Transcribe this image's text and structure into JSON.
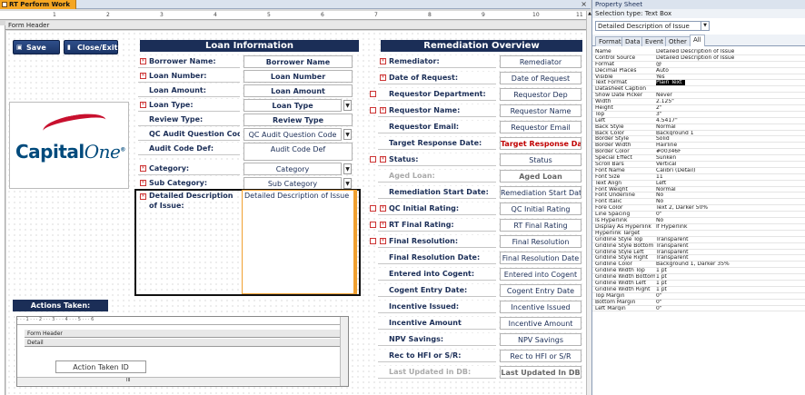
{
  "window": {
    "doc_tab": "RT Perform Work",
    "close_glyph": "×"
  },
  "ruler_numbers": [
    "1",
    "2",
    "3",
    "4",
    "5",
    "6",
    "7",
    "8",
    "9",
    "10",
    "11"
  ],
  "section_header": "Form Header",
  "buttons": {
    "save": "Save",
    "close_exit": "Close/Exit",
    "save_icon": "floppy-disk-icon",
    "close_icon": "door-exit-icon"
  },
  "logo": {
    "word": "Capital",
    "one": "One",
    "mark": "®"
  },
  "loan_info": {
    "title": "Loan Information",
    "rows": [
      {
        "label": "Borrower Name:",
        "value": "Borrower Name",
        "required": true
      },
      {
        "label": "Loan Number:",
        "value": "Loan Number",
        "required": true
      },
      {
        "label": "Loan Amount:",
        "value": "Loan Amount",
        "required": false
      },
      {
        "label": "Loan Type:",
        "value": "Loan Type",
        "required": true
      },
      {
        "label": "Review Type:",
        "value": "Review Type",
        "required": false
      },
      {
        "label": "QC Audit Question Code:",
        "value": "QC Audit Question Code",
        "required": false
      },
      {
        "label": "Audit Code Def:",
        "value": "Audit Code Def",
        "required": false
      },
      {
        "label": "Category:",
        "value": "Category",
        "required": true
      },
      {
        "label": "Sub Category:",
        "value": "Sub Category",
        "required": true
      }
    ],
    "description_label": "Detailed Description of Issue:",
    "description_value": "Detailed Description of Issue"
  },
  "remediation": {
    "title": "Remediation Overview",
    "rows": [
      {
        "label": "Remediator:",
        "value": "Remediator"
      },
      {
        "label": "Date of Request:",
        "value": "Date of Request"
      },
      {
        "label": "Requestor Department:",
        "value": "Requestor Dep"
      },
      {
        "label": "Requestor Name:",
        "value": "Requestor Name"
      },
      {
        "label": "Requestor Email:",
        "value": "Requestor Email"
      },
      {
        "label": "Target Response Date:",
        "value": "Target Response Date"
      },
      {
        "label": "Status:",
        "value": "Status"
      },
      {
        "label": "Aged Loan:",
        "value": "Aged Loan"
      },
      {
        "label": "Remediation Start Date:",
        "value": "Remediation Start Date"
      },
      {
        "label": "QC Initial Rating:",
        "value": "QC Initial Rating"
      },
      {
        "label": "RT Final Rating:",
        "value": "RT Final Rating"
      },
      {
        "label": "Final Resolution:",
        "value": "Final Resolution"
      },
      {
        "label": "Final Resolution Date:",
        "value": "Final Resolution Date"
      },
      {
        "label": "Entered into Cogent:",
        "value": "Entered into Cogent"
      },
      {
        "label": "Cogent Entry Date:",
        "value": "Cogent Entry Date"
      },
      {
        "label": "Incentive Issued:",
        "value": "Incentive Issued"
      },
      {
        "label": "Incentive Amount",
        "value": "Incentive Amount"
      },
      {
        "label": "NPV Savings:",
        "value": "NPV Savings"
      },
      {
        "label": "Rec to HFI or S/R:",
        "value": "Rec to HFI or S/R"
      },
      {
        "label": "Last Updated in DB:",
        "value": "Last Updated In DB"
      }
    ]
  },
  "actions": {
    "title": "Actions Taken:",
    "subform_ruler": "· · · 1 · · · 2 · · · 3 · · · 4 · · · 5 · · · 6",
    "form_header": "Form Header",
    "detail": "Detail",
    "field": "Action Taken ID",
    "scroll_mark": "III"
  },
  "property_sheet": {
    "title": "Property Sheet",
    "selection_type": "Selection type: Text Box",
    "selected": "Detailed Description of Issue",
    "tabs": [
      "Format",
      "Data",
      "Event",
      "Other",
      "All"
    ],
    "active_tab": "All",
    "rows": [
      {
        "k": "Name",
        "v": "Detailed Description of Issue"
      },
      {
        "k": "Control Source",
        "v": "Detailed Description of Issue"
      },
      {
        "k": "Format",
        "v": "@"
      },
      {
        "k": "Decimal Places",
        "v": "Auto"
      },
      {
        "k": "Visible",
        "v": "Yes"
      },
      {
        "k": "Text Format",
        "v": "Plain Text"
      },
      {
        "k": "Datasheet Caption",
        "v": ""
      },
      {
        "k": "Show Date Picker",
        "v": "Never"
      },
      {
        "k": "Width",
        "v": "2.125\""
      },
      {
        "k": "Height",
        "v": "2\""
      },
      {
        "k": "Top",
        "v": "3\""
      },
      {
        "k": "Left",
        "v": "4.5417\""
      },
      {
        "k": "Back Style",
        "v": "Normal"
      },
      {
        "k": "Back Color",
        "v": "Background 1"
      },
      {
        "k": "Border Style",
        "v": "Solid"
      },
      {
        "k": "Border Width",
        "v": "Hairline"
      },
      {
        "k": "Border Color",
        "v": "#00346F"
      },
      {
        "k": "Special Effect",
        "v": "Sunken"
      },
      {
        "k": "Scroll Bars",
        "v": "Vertical"
      },
      {
        "k": "Font Name",
        "v": "Calibri (Detail)"
      },
      {
        "k": "Font Size",
        "v": "11"
      },
      {
        "k": "Text Align",
        "v": "Left"
      },
      {
        "k": "Font Weight",
        "v": "Normal"
      },
      {
        "k": "Font Underline",
        "v": "No"
      },
      {
        "k": "Font Italic",
        "v": "No"
      },
      {
        "k": "Fore Color",
        "v": "Text 2, Darker 50%"
      },
      {
        "k": "Line Spacing",
        "v": "0\""
      },
      {
        "k": "Is Hyperlink",
        "v": "No"
      },
      {
        "k": "Display As Hyperlink",
        "v": "If Hyperlink"
      },
      {
        "k": "Hyperlink Target",
        "v": ""
      },
      {
        "k": "Gridline Style Top",
        "v": "Transparent"
      },
      {
        "k": "Gridline Style Bottom",
        "v": "Transparent"
      },
      {
        "k": "Gridline Style Left",
        "v": "Transparent"
      },
      {
        "k": "Gridline Style Right",
        "v": "Transparent"
      },
      {
        "k": "Gridline Color",
        "v": "Background 1, Darker 35%"
      },
      {
        "k": "Gridline Width Top",
        "v": "1 pt"
      },
      {
        "k": "Gridline Width Bottom",
        "v": "1 pt"
      },
      {
        "k": "Gridline Width Left",
        "v": "1 pt"
      },
      {
        "k": "Gridline Width Right",
        "v": "1 pt"
      },
      {
        "k": "Top Margin",
        "v": "0\""
      },
      {
        "k": "Bottom Margin",
        "v": "0\""
      },
      {
        "k": "Left Margin",
        "v": "0\""
      }
    ]
  }
}
